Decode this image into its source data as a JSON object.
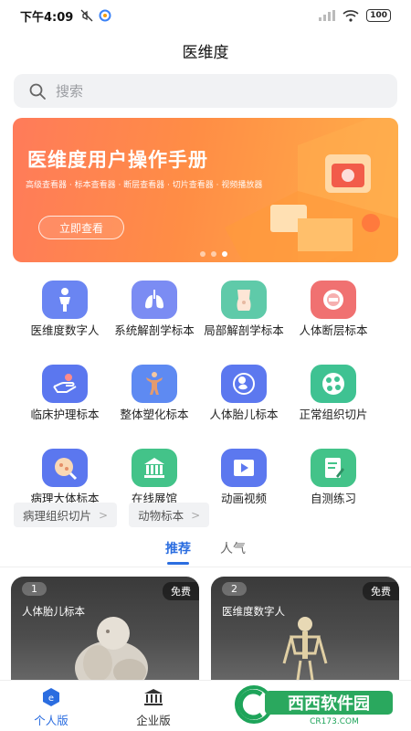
{
  "status": {
    "time": "下午4:09",
    "battery": "100"
  },
  "app": {
    "title": "医维度"
  },
  "search": {
    "placeholder": "搜索"
  },
  "banner": {
    "title": "医维度用户操作手册",
    "subtitle": "高级查看器 · 标本查看器 · 断层查看器 · 切片查看器 · 视频播放器",
    "button": "立即查看",
    "colors": {
      "start": "#ff7b5a",
      "end": "#ffb04a"
    }
  },
  "grid": [
    {
      "label": "医维度数字人",
      "icon": "human-body-icon",
      "color": "#5c7cf0"
    },
    {
      "label": "系统解剖学标本",
      "icon": "lungs-icon",
      "color": "#6c7ff2"
    },
    {
      "label": "局部解剖学标本",
      "icon": "torso-icon",
      "color": "#4fc3a8"
    },
    {
      "label": "人体断层标本",
      "icon": "cross-section-icon",
      "color": "#ef6a6a"
    },
    {
      "label": "临床护理标本",
      "icon": "hand-care-icon",
      "color": "#5a74ef"
    },
    {
      "label": "整体塑化标本",
      "icon": "plastinated-body-icon",
      "color": "#5a86f0"
    },
    {
      "label": "人体胎儿标本",
      "icon": "fetus-icon",
      "color": "#5c78ef"
    },
    {
      "label": "正常组织切片",
      "icon": "tissue-slice-icon",
      "color": "#3dbf8f"
    },
    {
      "label": "病理大体标本",
      "icon": "pathology-icon",
      "color": "#5a76ef"
    },
    {
      "label": "在线展馆",
      "icon": "museum-icon",
      "color": "#3fbf85"
    },
    {
      "label": "动画视频",
      "icon": "video-icon",
      "color": "#5c78ef"
    },
    {
      "label": "自测练习",
      "icon": "quiz-icon",
      "color": "#3fbf85"
    }
  ],
  "chips": [
    {
      "label": "病理组织切片"
    },
    {
      "label": "动物标本"
    }
  ],
  "tabs": [
    {
      "label": "推荐",
      "active": true
    },
    {
      "label": "人气",
      "active": false
    }
  ],
  "cards": [
    {
      "num": "1",
      "name": "人体胎儿标本",
      "badge": "免费"
    },
    {
      "num": "2",
      "name": "医维度数字人",
      "badge": "免费"
    }
  ],
  "nav": [
    {
      "label": "个人版",
      "icon": "personal-icon",
      "active": true
    },
    {
      "label": "企业版",
      "icon": "enterprise-icon",
      "active": false
    }
  ],
  "watermark": {
    "text": "西西软件园",
    "url": "CR173.COM"
  },
  "colors": {
    "accent": "#2b6de0"
  }
}
